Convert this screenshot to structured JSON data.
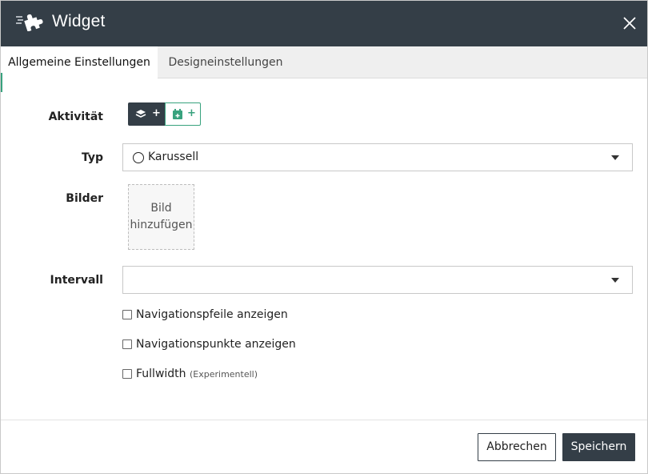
{
  "header": {
    "title": "Widget",
    "logo_icon": "puzzle-rocket-icon",
    "close_icon": "close-icon",
    "background": "#343e47"
  },
  "tabs": [
    {
      "label": "Allgemeine Einstellungen",
      "active": true
    },
    {
      "label": "Designeinstellungen",
      "active": false
    }
  ],
  "form": {
    "activity": {
      "label": "Aktivität",
      "buttons": [
        {
          "icon": "layers-icon",
          "symbol": "+"
        },
        {
          "icon": "calendar-add-icon",
          "symbol": "+"
        }
      ]
    },
    "type": {
      "label": "Typ",
      "value": "Karussell",
      "icon": "circle-icon"
    },
    "images": {
      "label": "Bilder",
      "dropzone_line1": "Bild",
      "dropzone_line2": "hinzufügen"
    },
    "interval": {
      "label": "Intervall",
      "value": ""
    },
    "checkboxes": [
      {
        "label": "Navigationspfeile anzeigen",
        "checked": false
      },
      {
        "label": "Navigationspunkte anzeigen",
        "checked": false
      },
      {
        "label": "Fullwidth",
        "note": "(Experimentell)",
        "checked": false
      }
    ]
  },
  "footer": {
    "cancel_label": "Abbrechen",
    "save_label": "Speichern"
  },
  "colors": {
    "dark": "#343e47",
    "accent_green": "#38a27e"
  }
}
